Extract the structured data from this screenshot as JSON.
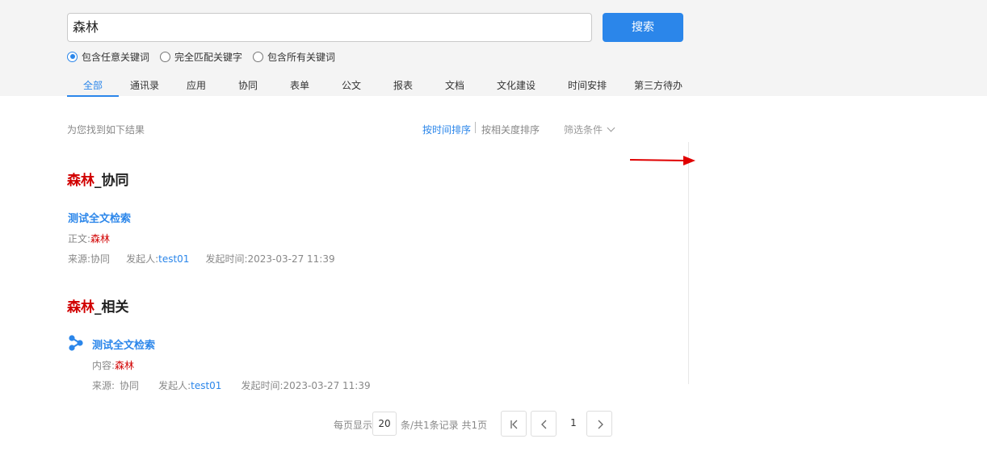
{
  "search": {
    "query": "森林",
    "button_label": "搜索"
  },
  "match_options": [
    {
      "label": "包含任意关键词",
      "checked": true
    },
    {
      "label": "完全匹配关键字",
      "checked": false
    },
    {
      "label": "包含所有关键词",
      "checked": false
    }
  ],
  "tabs": [
    {
      "label": "全部",
      "active": true
    },
    {
      "label": "通讯录",
      "active": false
    },
    {
      "label": "应用",
      "active": false
    },
    {
      "label": "协同",
      "active": false
    },
    {
      "label": "表单",
      "active": false
    },
    {
      "label": "公文",
      "active": false
    },
    {
      "label": "报表",
      "active": false
    },
    {
      "label": "文档",
      "active": false
    },
    {
      "label": "文化建设",
      "active": false
    },
    {
      "label": "时间安排",
      "active": false
    },
    {
      "label": "第三方待办",
      "active": false
    }
  ],
  "results_header": {
    "found_text": "为您找到如下结果",
    "sort_by_time": "按时间排序",
    "sort_by_relevance": "按相关度排序",
    "filter_label": "筛选条件"
  },
  "sections": [
    {
      "keyword": "森林",
      "suffix": "_协同",
      "item": {
        "title": "测试全文检索",
        "body_label": "正文:",
        "body_value": "森林",
        "source_label": "来源:",
        "source_value": "协同",
        "initiator_label": "发起人:",
        "initiator_value": "test01",
        "time_label": "发起时间:",
        "time_value": "2023-03-27 11:39"
      }
    },
    {
      "keyword": "森林",
      "suffix": "_相关",
      "item": {
        "title": "测试全文检索",
        "body_label": "内容:",
        "body_value": "森林",
        "source_label": "来源:",
        "source_value": "协同",
        "initiator_label": "发起人:",
        "initiator_value": "test01",
        "time_label": "发起时间:",
        "time_value": "2023-03-27 11:39"
      }
    }
  ],
  "pagination": {
    "per_page_label": "每页显示",
    "per_page_value": "20",
    "summary": "条/共1条记录 共1页",
    "current_page": "1"
  },
  "colors": {
    "accent": "#2b86ea",
    "keyword": "#d10000",
    "annotation_arrow": "#e00000"
  }
}
